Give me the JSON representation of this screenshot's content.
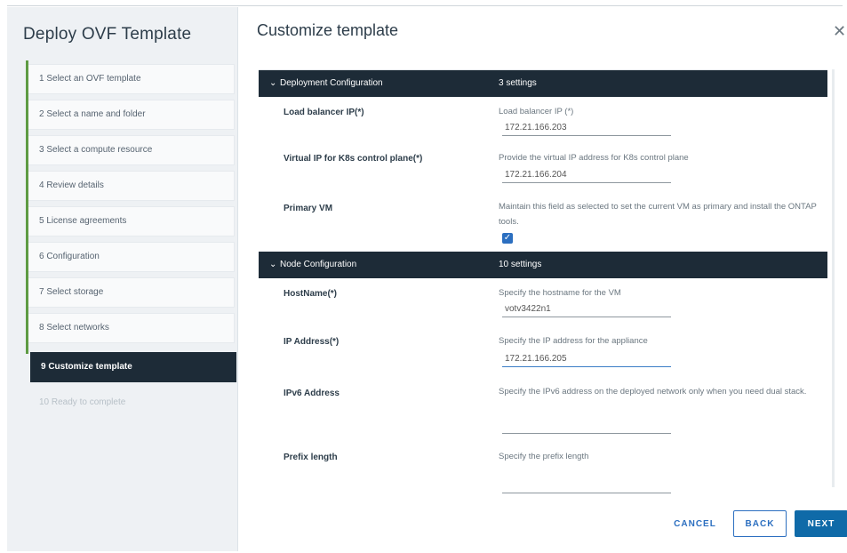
{
  "wizard": {
    "title": "Deploy OVF Template",
    "steps": [
      {
        "label": "1  Select an OVF template"
      },
      {
        "label": "2  Select a name and folder"
      },
      {
        "label": "3  Select a compute resource"
      },
      {
        "label": "4  Review details"
      },
      {
        "label": "5  License agreements"
      },
      {
        "label": "6  Configuration"
      },
      {
        "label": "7  Select storage"
      },
      {
        "label": "8  Select networks"
      },
      {
        "label": "9  Customize template"
      },
      {
        "label": "10  Ready to complete"
      }
    ],
    "active_step": 9,
    "accent_color": "#5e9b43"
  },
  "content": {
    "title": "Customize template",
    "close_icon": "close-icon"
  },
  "sections": {
    "deployment": {
      "name": "Deployment Configuration",
      "count": "3 settings",
      "rows": {
        "lb": {
          "label": "Load balancer IP(*)",
          "desc": "Load balancer IP (*)",
          "value": "172.21.166.203"
        },
        "vip": {
          "label": "Virtual IP for K8s control plane(*)",
          "desc": "Provide the virtual IP address for K8s control plane",
          "value": "172.21.166.204"
        },
        "primary": {
          "label": "Primary VM",
          "desc": "Maintain this field as selected to set the current VM as primary and install the ONTAP tools.",
          "checked": true
        }
      }
    },
    "node": {
      "name": "Node Configuration",
      "count": "10 settings",
      "rows": {
        "hostname": {
          "label": "HostName(*)",
          "desc": "Specify the hostname for the VM",
          "value": "votv3422n1"
        },
        "ip": {
          "label": "IP Address(*)",
          "desc": "Specify the IP address for the appliance",
          "value": "172.21.166.205"
        },
        "ipv6": {
          "label": "IPv6 Address",
          "desc": "Specify the IPv6 address on the deployed network only when you need dual stack.",
          "value": ""
        },
        "prefix": {
          "label": "Prefix length",
          "desc": "Specify the prefix length",
          "value": ""
        }
      }
    }
  },
  "footer": {
    "cancel": "CANCEL",
    "back": "BACK",
    "next": "NEXT"
  },
  "colors": {
    "header_dark": "#1d2b37",
    "primary_blue": "#0f6aa8",
    "link_blue": "#2c6fc0"
  }
}
